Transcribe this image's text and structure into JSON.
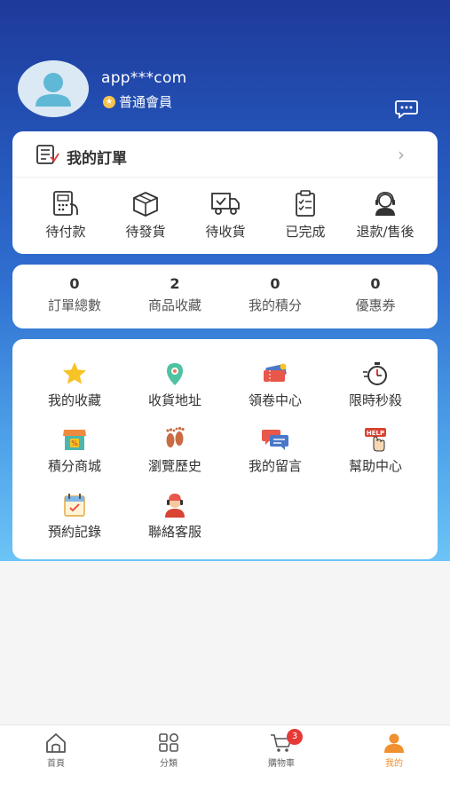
{
  "profile": {
    "username": "app***com",
    "level": "普通會員",
    "level_badge_icon": "star-badge-icon",
    "message_icon": "chat-bubble-icon"
  },
  "orders": {
    "title": "我的訂單",
    "more_icon": "chevron-right-icon",
    "items": [
      {
        "label": "待付款",
        "icon": "pay-icon"
      },
      {
        "label": "待發貨",
        "icon": "box-icon"
      },
      {
        "label": "待收貨",
        "icon": "truck-icon"
      },
      {
        "label": "已完成",
        "icon": "clipboard-check-icon"
      },
      {
        "label": "退款/售後",
        "icon": "service-agent-icon"
      }
    ]
  },
  "stats": [
    {
      "value": "0",
      "label": "訂單總數"
    },
    {
      "value": "2",
      "label": "商品收藏"
    },
    {
      "value": "0",
      "label": "我的積分"
    },
    {
      "value": "0",
      "label": "優惠券"
    }
  ],
  "tools": [
    {
      "label": "我的收藏",
      "icon": "star-icon"
    },
    {
      "label": "收貨地址",
      "icon": "location-pin-icon"
    },
    {
      "label": "領卷中心",
      "icon": "coupon-icon"
    },
    {
      "label": "限時秒殺",
      "icon": "stopwatch-icon"
    },
    {
      "label": "積分商城",
      "icon": "shop-icon"
    },
    {
      "label": "瀏覽歷史",
      "icon": "footprints-icon"
    },
    {
      "label": "我的留言",
      "icon": "message-icon"
    },
    {
      "label": "幫助中心",
      "icon": "help-icon"
    },
    {
      "label": "預約記錄",
      "icon": "calendar-icon"
    },
    {
      "label": "聯絡客服",
      "icon": "customer-service-icon"
    }
  ],
  "tabbar": [
    {
      "label": "首頁",
      "icon": "home-icon",
      "active": false
    },
    {
      "label": "分類",
      "icon": "grid-icon",
      "active": false
    },
    {
      "label": "購物車",
      "icon": "cart-icon",
      "active": false,
      "badge": "3"
    },
    {
      "label": "我的",
      "icon": "user-icon",
      "active": true
    }
  ],
  "colors": {
    "header_gradient_top": "#1e3a9a",
    "header_gradient_bottom": "#6cc4f6",
    "active_tab": "#f0902e",
    "badge": "#e53935"
  }
}
